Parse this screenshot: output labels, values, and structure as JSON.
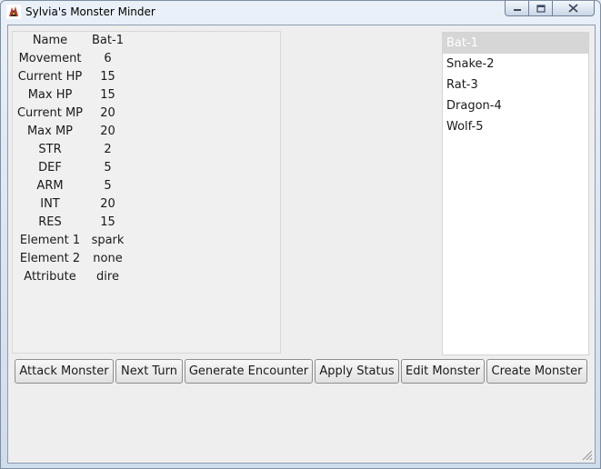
{
  "window": {
    "title": "Sylvia's Monster Minder"
  },
  "stats": [
    {
      "label": "Name",
      "value": "Bat-1"
    },
    {
      "label": "Movement",
      "value": "6"
    },
    {
      "label": "Current HP",
      "value": "15"
    },
    {
      "label": "Max HP",
      "value": "15"
    },
    {
      "label": "Current MP",
      "value": "20"
    },
    {
      "label": "Max MP",
      "value": "20"
    },
    {
      "label": "STR",
      "value": "2"
    },
    {
      "label": "DEF",
      "value": "5"
    },
    {
      "label": "ARM",
      "value": "5"
    },
    {
      "label": "INT",
      "value": "20"
    },
    {
      "label": "RES",
      "value": "15"
    },
    {
      "label": "Element 1",
      "value": "spark"
    },
    {
      "label": "Element 2",
      "value": "none"
    },
    {
      "label": "Attribute",
      "value": "dire"
    }
  ],
  "monsters": {
    "selected": "Bat-1",
    "items": [
      "Bat-1",
      "Snake-2",
      "Rat-3",
      "Dragon-4",
      "Wolf-5"
    ]
  },
  "buttons": {
    "attack": "Attack Monster",
    "next_turn": "Next Turn",
    "generate": "Generate Encounter",
    "apply_status": "Apply Status",
    "edit": "Edit Monster",
    "create": "Create Monster"
  },
  "icons": {
    "app": "monster-app-icon",
    "minimize": "minimize-icon",
    "maximize": "maximize-icon",
    "close": "close-icon",
    "resize": "resize-grip-icon"
  },
  "colors": {
    "selection": "#d6d6d6",
    "panel": "#eeeeee",
    "titlebar": "#dfe8f3"
  }
}
